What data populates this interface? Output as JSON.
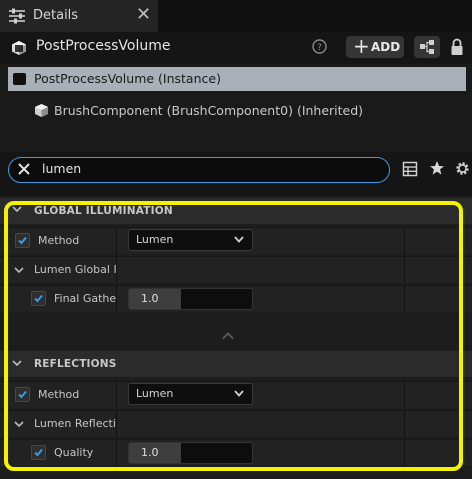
{
  "tab": {
    "title": "Details",
    "close_glyph": "✕",
    "icon": "details-sliders-icon"
  },
  "header": {
    "actor_name": "PostProcessVolume",
    "add_label": "ADD",
    "add_glyph": "+",
    "icons": [
      "cube-icon",
      "help-icon",
      "blueprint-icon",
      "lock-icon"
    ]
  },
  "tree": {
    "items": [
      {
        "label": "PostProcessVolume (Instance)",
        "selected": true,
        "icon": "cube-icon"
      },
      {
        "label": "BrushComponent (BrushComponent0) (Inherited)",
        "selected": false,
        "icon": "component-cube-icon"
      }
    ]
  },
  "search": {
    "value": "lumen"
  },
  "categories": [
    {
      "name": "GLOBAL ILLUMINATION",
      "method": {
        "label": "Method",
        "value": "Lumen",
        "checked": true
      },
      "subgroup": {
        "label": "Lumen Global Illumination",
        "display": "Lumen Global Illı"
      },
      "property": {
        "label": "Final Gather Quality",
        "display": "Final Gather",
        "value": "1.0",
        "checked": true,
        "fill_fraction": 0.42
      }
    },
    {
      "name": "REFLECTIONS",
      "method": {
        "label": "Method",
        "value": "Lumen",
        "checked": true
      },
      "subgroup": {
        "label": "Lumen Reflections",
        "display": "Lumen Reflectio"
      },
      "property": {
        "label": "Quality",
        "display": "Quality",
        "value": "1.0",
        "checked": true,
        "fill_fraction": 0.42
      }
    }
  ],
  "colors": {
    "accent_blue": "#3e9ae0",
    "selection": "#a9b0b8",
    "highlight": "#f4f400"
  }
}
